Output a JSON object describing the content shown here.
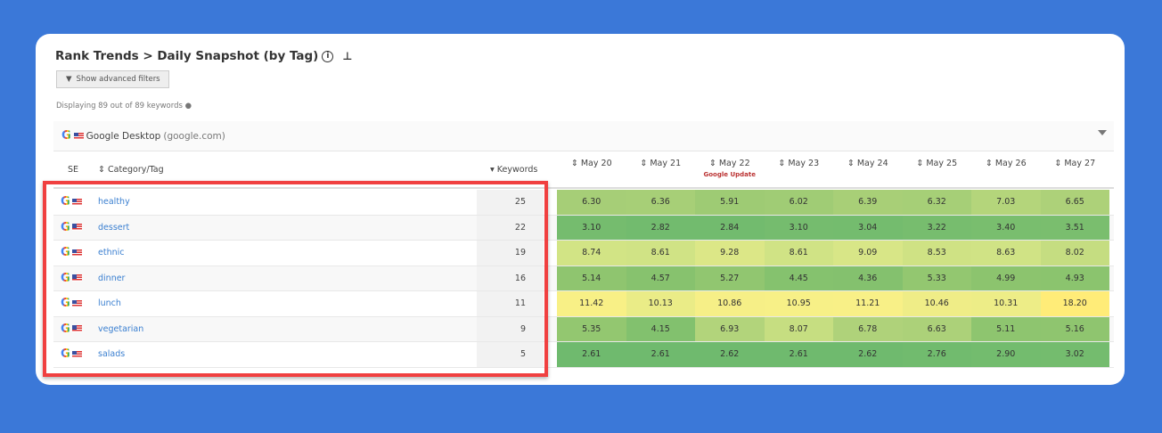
{
  "header": {
    "title": "Rank Trends > Daily Snapshot (by Tag)",
    "filters_button": "Show advanced filters",
    "displaying": "Displaying 89 out of 89 keywords"
  },
  "engine": {
    "name": "Google Desktop",
    "domain": "(google.com)"
  },
  "columns": {
    "se": "SE",
    "tag": "Category/Tag",
    "keywords": "Keywords",
    "dates": [
      "May 20",
      "May 21",
      "May 22",
      "May 23",
      "May 24",
      "May 25",
      "May 26",
      "May 27"
    ],
    "annotation": "Google Update"
  },
  "rows": [
    {
      "tag": "healthy",
      "keywords": "25",
      "values": [
        "6.30",
        "6.36",
        "5.91",
        "6.02",
        "6.39",
        "6.32",
        "7.03",
        "6.65"
      ]
    },
    {
      "tag": "dessert",
      "keywords": "22",
      "values": [
        "3.10",
        "2.82",
        "2.84",
        "3.10",
        "3.04",
        "3.22",
        "3.40",
        "3.51"
      ]
    },
    {
      "tag": "ethnic",
      "keywords": "19",
      "values": [
        "8.74",
        "8.61",
        "9.28",
        "8.61",
        "9.09",
        "8.53",
        "8.63",
        "8.02"
      ]
    },
    {
      "tag": "dinner",
      "keywords": "16",
      "values": [
        "5.14",
        "4.57",
        "5.27",
        "4.45",
        "4.36",
        "5.33",
        "4.99",
        "4.93"
      ]
    },
    {
      "tag": "lunch",
      "keywords": "11",
      "values": [
        "11.42",
        "10.13",
        "10.86",
        "10.95",
        "11.21",
        "10.46",
        "10.31",
        "18.20"
      ]
    },
    {
      "tag": "vegetarian",
      "keywords": "9",
      "values": [
        "5.35",
        "4.15",
        "6.93",
        "8.07",
        "6.78",
        "6.63",
        "5.11",
        "5.16"
      ]
    },
    {
      "tag": "salads",
      "keywords": "5",
      "values": [
        "2.61",
        "2.61",
        "2.62",
        "2.61",
        "2.62",
        "2.76",
        "2.90",
        "3.02"
      ]
    }
  ],
  "colors": {
    "background": "#3b78d8",
    "highlight": "#f04040"
  }
}
